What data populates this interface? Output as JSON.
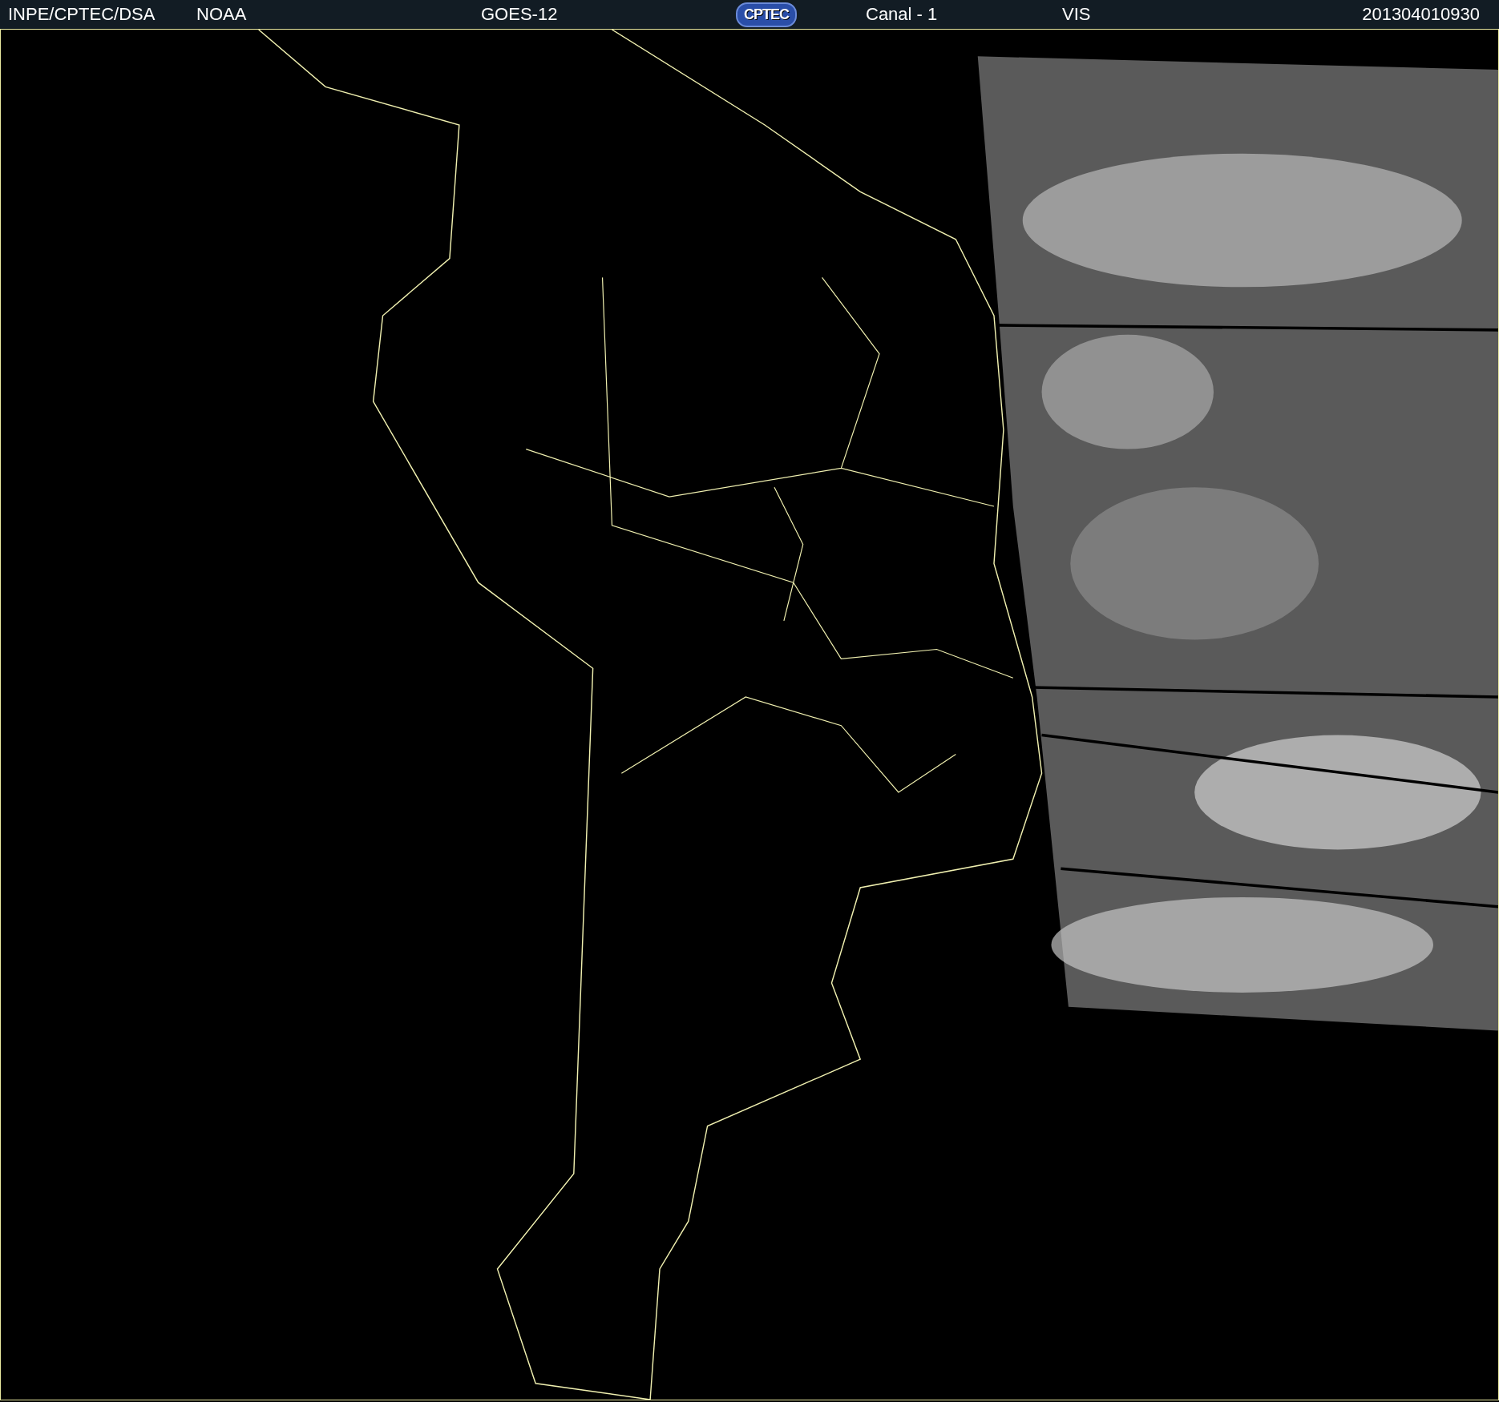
{
  "header": {
    "items": [
      {
        "kind": "text",
        "text": "INPE/CPTEC/DSA"
      },
      {
        "kind": "text",
        "text": "NOAA"
      },
      {
        "kind": "text",
        "text": "GOES-12"
      },
      {
        "kind": "logo",
        "text": "CPTEC"
      },
      {
        "kind": "text",
        "text": "Canal - 1"
      },
      {
        "kind": "text",
        "text": "VIS"
      },
      {
        "kind": "text",
        "text": "201304010930"
      }
    ]
  }
}
